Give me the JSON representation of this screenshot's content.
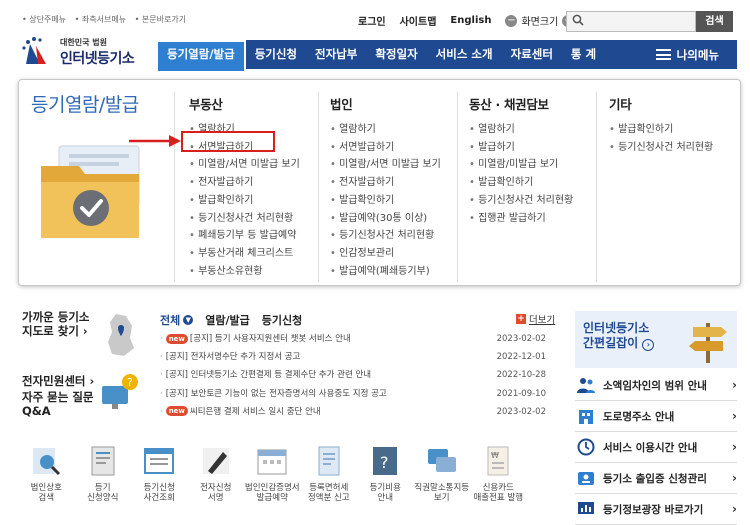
{
  "util_links": [
    "상단주메뉴",
    "좌측서브메뉴",
    "본문바로가기"
  ],
  "top_links": {
    "login": "로그인",
    "sitemap": "사이트맵",
    "english": "English",
    "zoom_label": "화면크기",
    "zoom_minus": "−",
    "zoom_plus": "+"
  },
  "search": {
    "button": "검색",
    "placeholder": ""
  },
  "logo": {
    "line1": "대한민국 법원",
    "line2": "인터넷등기소"
  },
  "gnb": {
    "items": [
      "등기열람/발급",
      "등기신청",
      "전자납부",
      "확정일자",
      "서비스 소개",
      "자료센터",
      "통 계"
    ],
    "my_menu": "나의메뉴"
  },
  "mega_menu": {
    "title": "등기열람/발급",
    "columns": [
      {
        "heading": "부동산",
        "items": [
          "열람하기",
          "서면발급하기",
          "미열람/서면 미발급 보기",
          "전자발급하기",
          "발급확인하기",
          "등기신청사건 처리현황",
          "폐쇄등기부 등 발급예약",
          "부동산거래 체크리스트",
          "부동산소유현황"
        ]
      },
      {
        "heading": "법인",
        "items": [
          "열람하기",
          "서면발급하기",
          "미열람/서면 미발급 보기",
          "전자발급하기",
          "발급확인하기",
          "발급예약(30통 이상)",
          "등기신청사건 처리현황",
          "인감정보관리",
          "발급예약(폐쇄등기부)"
        ]
      },
      {
        "heading": "동산 · 채권담보",
        "items": [
          "열람하기",
          "발급하기",
          "미열람/미발급 보기",
          "발급확인하기",
          "등기신청사건 처리현황",
          "집행관 발급하기"
        ]
      },
      {
        "heading": "기타",
        "items": [
          "발급확인하기",
          "등기신청사건 처리현황"
        ]
      }
    ]
  },
  "left_side": {
    "find_office": "가까운 등기소\n지도로 찾기 ›",
    "e_civil": "전자민원센터 ›",
    "faq": "자주 묻는 질문\nQ&A"
  },
  "notice_tabs": {
    "all": "전체",
    "tab1": "열람/발급",
    "tab2": "등기신청",
    "more": "더보기"
  },
  "notices": [
    {
      "new": true,
      "text": "[공지] 등기 사용자지원센터 챗봇 서비스 안내",
      "date": "2023-02-02"
    },
    {
      "new": false,
      "text": "[공지] 전자서명수단 추가 지정서 공고",
      "date": "2022-12-01"
    },
    {
      "new": false,
      "text": "[공지] 인터넷등기소 간편결제 등 결제수단 추가 관련 안내",
      "date": "2022-10-28"
    },
    {
      "new": false,
      "text": "[공지] 보안토큰 기능이 없는 전자증명서의 사용중도 지정 공고",
      "date": "2021-09-10"
    },
    {
      "new": true,
      "text": "씨티은행 결제 서비스 일시 중단 안내",
      "date": "2023-02-02"
    }
  ],
  "new_badge": "new",
  "banner": {
    "line1": "인터넷등기소",
    "line2": "간편길잡이"
  },
  "side_list": [
    "소액임차인의 범위 안내",
    "도로명주소 안내",
    "서비스 이용시간 안내",
    "등기소 출입증 신청관리",
    "등기정보광장 바로가기"
  ],
  "quick_menu": [
    "법인상호\n검색",
    "등기\n신청양식",
    "등기신청\n사건조회",
    "전자신청\n서명",
    "법인인감증명서\n발급예약",
    "등록면허세\n정액분 신고",
    "등기비용\n안내",
    "직권말소통지등\n보기",
    "신용카드\n매출전표 발행"
  ],
  "colors": {
    "nav_bg": "#1f4a92",
    "nav_active": "#2f7fd0",
    "title_blue": "#2e6ab8",
    "highlight_red": "#d62020"
  }
}
